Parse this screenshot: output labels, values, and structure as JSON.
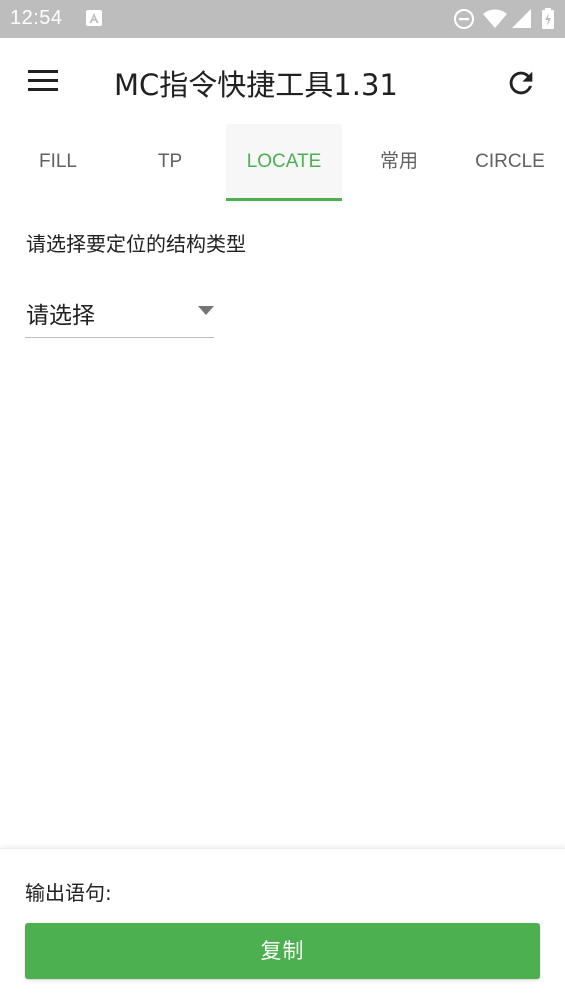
{
  "status_bar": {
    "time": "12:54",
    "icons": [
      "a-notification-icon",
      "do-not-disturb-icon",
      "wifi-icon",
      "signal-icon",
      "battery-icon"
    ]
  },
  "app_bar": {
    "title": "MC指令快捷工具1.31",
    "menu_icon": "menu-icon",
    "refresh_icon": "refresh-icon"
  },
  "tabs": [
    {
      "label": "FILL",
      "active": false
    },
    {
      "label": "TP",
      "active": false
    },
    {
      "label": "LOCATE",
      "active": true
    },
    {
      "label": "常用",
      "active": false
    },
    {
      "label": "CIRCLE",
      "active": false
    }
  ],
  "locate": {
    "prompt": "请选择要定位的结构类型",
    "spinner_value": "请选择"
  },
  "output": {
    "label": "输出语句:",
    "copy_button": "复制"
  },
  "colors": {
    "accent": "#4caf50",
    "status_bar": "#bdbdbd",
    "text": "#212121",
    "tab_text": "#616161"
  }
}
